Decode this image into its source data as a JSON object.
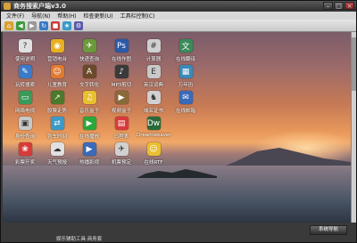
{
  "window": {
    "title": "商务搜索户端v3.0"
  },
  "menu": [
    "文件(F)",
    "导航(N)",
    "帮助(H)",
    "检查更新(U)",
    "工具栏控制(C)"
  ],
  "toolbar": [
    {
      "name": "home-icon",
      "color": "#d8a030",
      "glyph": "⌂"
    },
    {
      "name": "back-icon",
      "color": "#3a9a3a",
      "glyph": "◀"
    },
    {
      "name": "forward-icon",
      "color": "#999999",
      "glyph": "▶"
    },
    {
      "name": "refresh-icon",
      "color": "#3a7ac8",
      "glyph": "↻"
    },
    {
      "name": "stop-icon",
      "color": "#c83a3a",
      "glyph": "■"
    },
    {
      "name": "favorites-icon",
      "color": "#3a9ac8",
      "glyph": "★"
    },
    {
      "name": "settings-icon",
      "color": "#5a5aaa",
      "glyph": "⚙"
    }
  ],
  "desktop_icons": [
    {
      "label": "使用说明",
      "icon": "help-book-icon",
      "color": "#e0e0e0",
      "glyph": "?"
    },
    {
      "label": "营销电台",
      "icon": "radio-icon",
      "color": "#e8b020",
      "glyph": "◉"
    },
    {
      "label": "快递查询",
      "icon": "delivery-icon",
      "color": "#6a9a3a",
      "glyph": "✈"
    },
    {
      "label": "在线作图",
      "icon": "photoshop-icon",
      "color": "#2a5aa8",
      "glyph": "Ps"
    },
    {
      "label": "计算器",
      "icon": "calculator-icon",
      "color": "#d0d0d0",
      "glyph": "#"
    },
    {
      "label": "在线翻译",
      "icon": "translate-icon",
      "color": "#3a8a5a",
      "glyph": "文"
    },
    {
      "label": "玩转搜索",
      "icon": "tool-icon",
      "color": "#3a7ac8",
      "glyph": "✎"
    },
    {
      "label": "儿童教育",
      "icon": "cartoon-icon",
      "color": "#e07a30",
      "glyph": "☺"
    },
    {
      "label": "文字转化",
      "icon": "text-convert-icon",
      "color": "#6a4a2a",
      "glyph": "A"
    },
    {
      "label": "MP3剪切",
      "icon": "mp3-icon",
      "color": "#3a3a3a",
      "glyph": "♪"
    },
    {
      "label": "英汉词典",
      "icon": "dictionary-icon",
      "color": "#c8c8c8",
      "glyph": "E"
    },
    {
      "label": "万年历",
      "icon": "calendar-icon",
      "color": "#3a8ab8",
      "glyph": "▦"
    },
    {
      "label": "网络电视",
      "icon": "tv-icon",
      "color": "#3a9a5a",
      "glyph": "▭"
    },
    {
      "label": "股票走势",
      "icon": "stock-icon",
      "color": "#4a7a2a",
      "glyph": "↗"
    },
    {
      "label": "音乐盒子",
      "icon": "music-box-icon",
      "color": "#e8c030",
      "glyph": "♫"
    },
    {
      "label": "视频盒子",
      "icon": "video-box-icon",
      "color": "#8a6a3a",
      "glyph": "▶"
    },
    {
      "label": "域名证书",
      "icon": "domain-icon",
      "color": "#d0d0d0",
      "glyph": "♞"
    },
    {
      "label": "在线邮箱",
      "icon": "mailbox-icon",
      "color": "#3a6ab8",
      "glyph": "✉"
    },
    {
      "label": "身份查询",
      "icon": "id-card-icon",
      "color": "#c8c8c8",
      "glyph": "▣"
    },
    {
      "label": "列车时刻",
      "icon": "train-icon",
      "color": "#3a9ac8",
      "glyph": "⇄"
    },
    {
      "label": "在线播放",
      "icon": "play-icon",
      "color": "#2aa83a",
      "glyph": "▶"
    },
    {
      "label": "日程表",
      "icon": "schedule-icon",
      "color": "#d83a3a",
      "glyph": "▤"
    },
    {
      "label": "Dreamweaver",
      "icon": "dreamweaver-icon",
      "color": "#2a6a3a",
      "glyph": "Dw"
    },
    {
      "label": "彩票开奖",
      "icon": "lottery-icon",
      "color": "#d83a3a",
      "glyph": "❀"
    },
    {
      "label": "天气预报",
      "icon": "weather-icon",
      "color": "#e0e0e0",
      "glyph": "☁"
    },
    {
      "label": "热播影视",
      "icon": "movie-icon",
      "color": "#3a6ab8",
      "glyph": "▶"
    },
    {
      "label": "机票预定",
      "icon": "flight-ticket-icon",
      "color": "#d0d0d0",
      "glyph": "✈"
    },
    {
      "label": "在线RTF",
      "icon": "rtf-icon",
      "color": "#e8c030",
      "glyph": "☺"
    }
  ],
  "status": {
    "text": "娱乐辅助工具·商务套",
    "nav_button": "系统导航"
  }
}
